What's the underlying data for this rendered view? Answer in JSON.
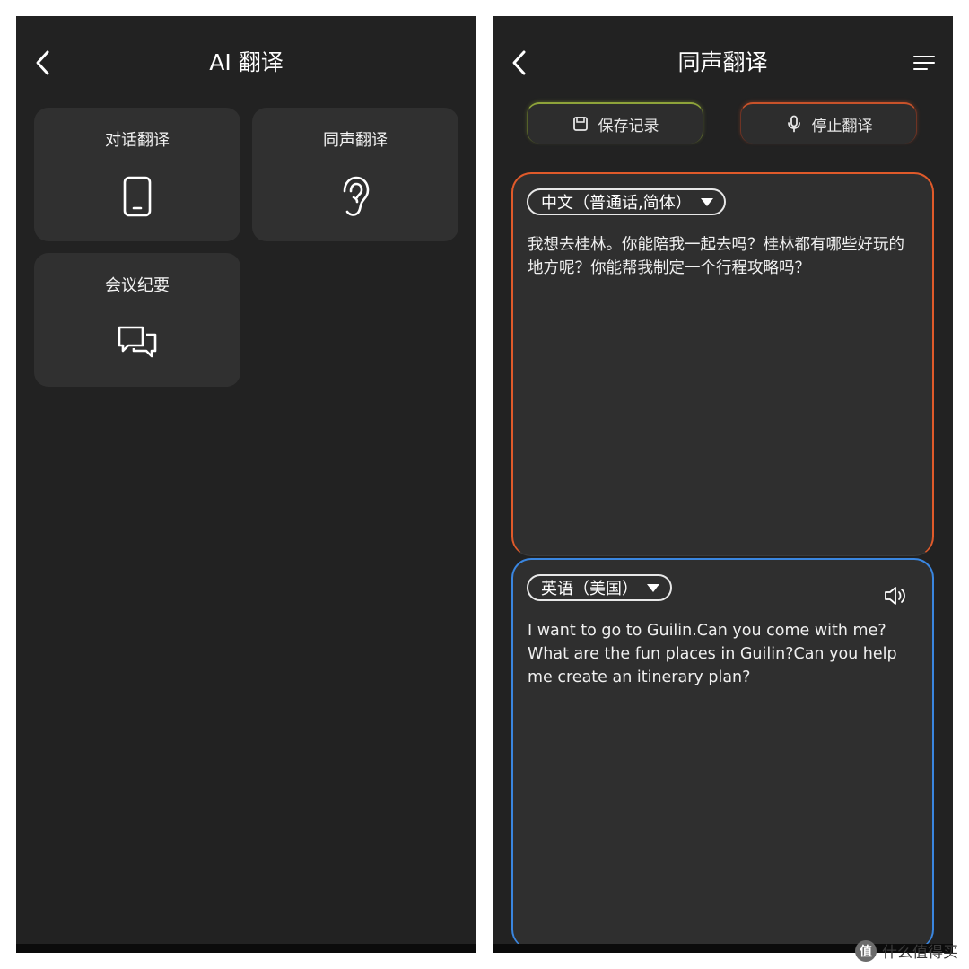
{
  "left_screen": {
    "title": "AI 翻译",
    "cards": [
      {
        "label": "对话翻译",
        "icon": "phone-icon"
      },
      {
        "label": "同声翻译",
        "icon": "ear-icon"
      },
      {
        "label": "会议纪要",
        "icon": "chat-bubbles-icon"
      }
    ]
  },
  "right_screen": {
    "title": "同声翻译",
    "actions": {
      "save_label": "保存记录",
      "stop_label": "停止翻译"
    },
    "source": {
      "language": "中文（普通话,简体）",
      "text": "我想去桂林。你能陪我一起去吗？桂林都有哪些好玩的地方呢？你能帮我制定一个行程攻略吗？"
    },
    "target": {
      "language": "英语（美国）",
      "text": "I want to go to Guilin.Can you come with me? What are the fun places in Guilin?Can you help me create an itinerary plan?"
    }
  },
  "watermark": {
    "logo_text": "值",
    "text": "什么值得买"
  },
  "colors": {
    "background": "#222222",
    "card": "#303030",
    "source_border": "#e05a2a",
    "target_border": "#3a86e0",
    "save_accent": "#8ea33a",
    "stop_accent": "#c8522a"
  }
}
